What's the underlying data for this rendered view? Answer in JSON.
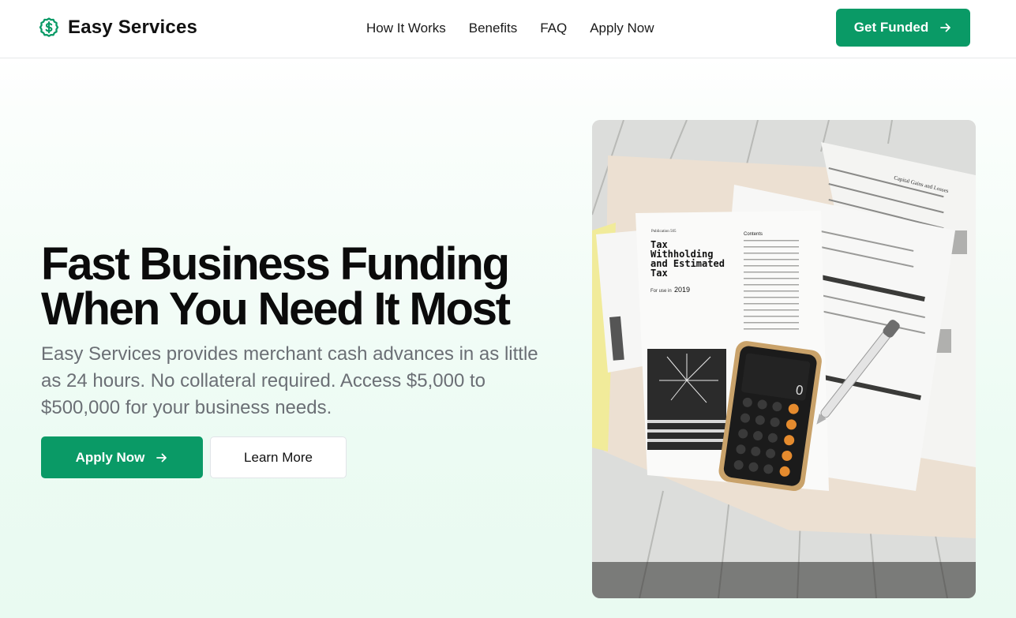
{
  "header": {
    "brand_name": "Easy Services",
    "brand_icon": "dollar-circle-icon",
    "nav": [
      "How It Works",
      "Benefits",
      "FAQ",
      "Apply Now"
    ],
    "cta_label": "Get Funded"
  },
  "hero": {
    "title_line1": "Fast Business Funding",
    "title_line2": "When You Need It Most",
    "description": "Easy Services provides merchant cash advances in as little as 24 hours. No collateral required. Access $5,000 to $500,000 for your business needs.",
    "primary_button": "Apply Now",
    "secondary_button": "Learn More"
  },
  "image": {
    "publication": "Publication 505",
    "doc_title_1": "Tax",
    "doc_title_2": "Withholding",
    "doc_title_3": "and Estimated",
    "doc_title_4": "Tax",
    "doc_year_label": "For use in",
    "doc_year": "2019",
    "contents_label": "Contents",
    "form_label": "Capital Gains and Losses",
    "calculator_display": "0"
  },
  "colors": {
    "accent": "#0a9a66",
    "title": "#0b0b0b",
    "muted": "#6b6f75"
  }
}
